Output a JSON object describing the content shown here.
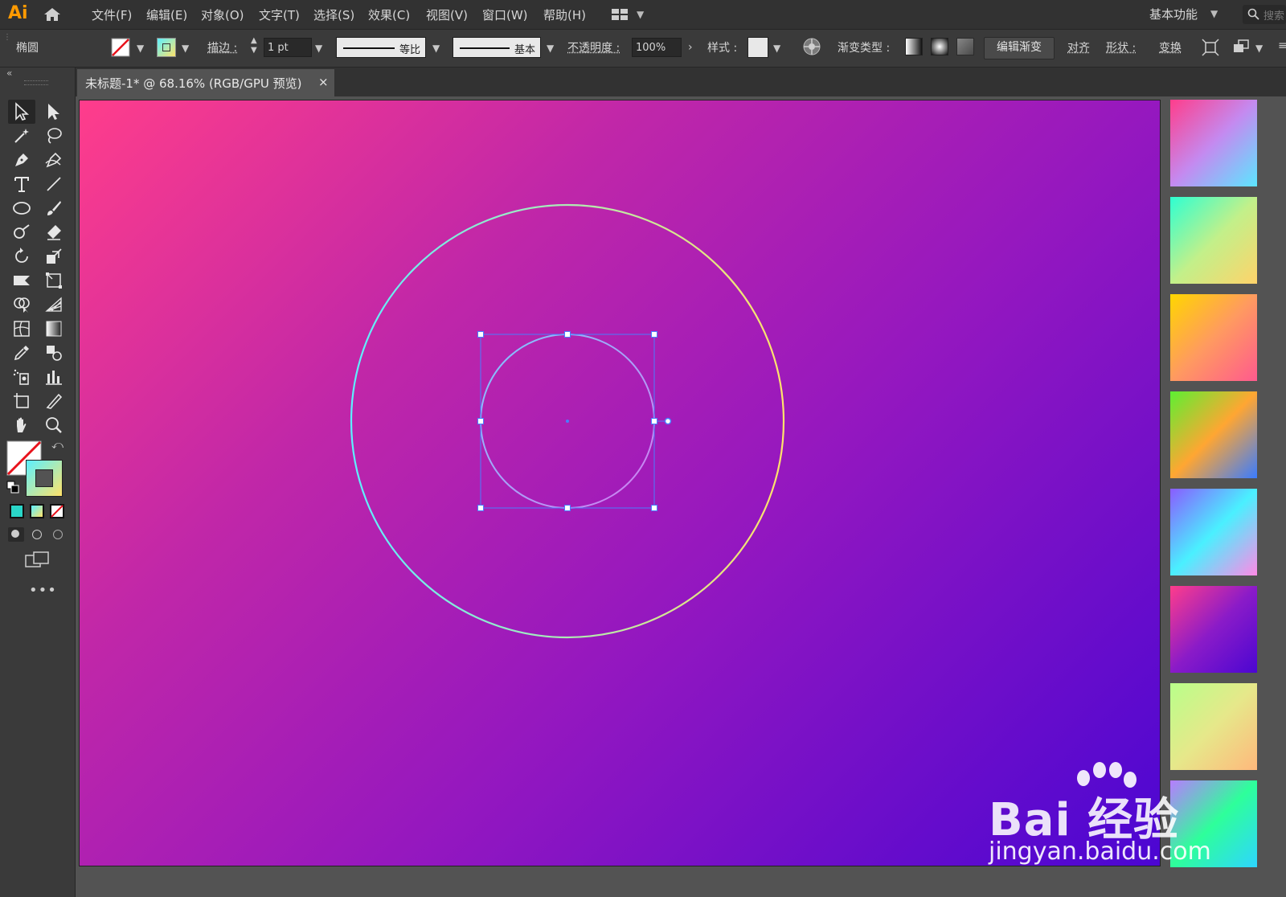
{
  "app": {
    "logo": "Ai",
    "accent": "#ff9a00"
  },
  "menu": {
    "items": [
      "文件(F)",
      "编辑(E)",
      "对象(O)",
      "文字(T)",
      "选择(S)",
      "效果(C)",
      "视图(V)",
      "窗口(W)",
      "帮助(H)"
    ],
    "workspace": "基本功能",
    "search_placeholder": "搜索"
  },
  "control_bar": {
    "object_type": "椭圆",
    "stroke_label": "描边 :",
    "stroke_weight": "1 pt",
    "profile_label": "等比",
    "brush_label": "基本",
    "opacity_label": "不透明度 :",
    "opacity_value": "100%",
    "style_label": "样式 :",
    "gradient_type_label": "渐变类型 :",
    "edit_gradient_button": "编辑渐变",
    "align_label": "对齐",
    "shape_label": "形状 :",
    "transform_label": "变换"
  },
  "document": {
    "tab_title": "未标题-1* @ 68.16% (RGB/GPU 预览)",
    "close": "×"
  },
  "colors": {
    "artboard_gradient": [
      "#ff3d8b",
      "#c127a8",
      "#9317c0",
      "#4b06d2"
    ],
    "outer_circle_stroke": [
      "#5cf0ff",
      "#ffe36a"
    ],
    "inner_circle_stroke": [
      "#7cc8ff",
      "#d47cf0"
    ],
    "selection": "#4a7dff"
  },
  "swatches": [
    {
      "name": "pink-blue",
      "colors": [
        "#ff3d8b",
        "#c48af0",
        "#5ce6ff"
      ]
    },
    {
      "name": "cyan-yellow",
      "colors": [
        "#2effd2",
        "#c2f08a",
        "#ffd36a"
      ]
    },
    {
      "name": "yellow-pink",
      "colors": [
        "#ffd600",
        "#ff9a60",
        "#ff5a8e"
      ]
    },
    {
      "name": "green-orange-blue",
      "colors": [
        "#5cf032",
        "#ffa632",
        "#3a7cff"
      ]
    },
    {
      "name": "purple-cyan-pink",
      "colors": [
        "#8a5cff",
        "#4af0ff",
        "#ff8ae6"
      ]
    },
    {
      "name": "pink-indigo",
      "colors": [
        "#ff3d8b",
        "#8a1bc8",
        "#4b06d2"
      ]
    },
    {
      "name": "green-peach",
      "colors": [
        "#b8ff8a",
        "#e6e88a",
        "#ffb87c"
      ]
    },
    {
      "name": "purple-green-cyan",
      "colors": [
        "#b77cff",
        "#2eff9a",
        "#2ed6ff"
      ]
    }
  ],
  "watermark": {
    "text": "Bai 经验",
    "url": "jingyan.baidu.com"
  }
}
